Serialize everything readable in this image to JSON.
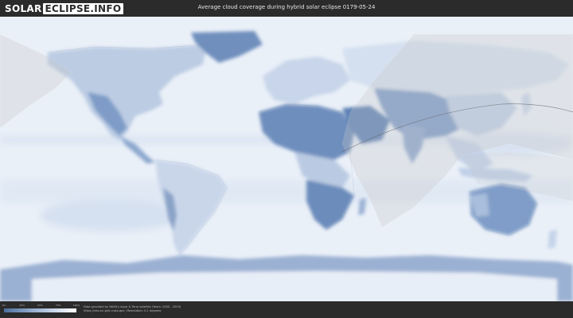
{
  "header": {
    "logo_part1": "SOLAR",
    "logo_part2": "ECLIPSE.INFO",
    "title": "Average cloud coverage during hybrid solar eclipse 0179-05-24"
  },
  "legend": {
    "ticks": [
      "0%",
      "25%",
      "50%",
      "75%",
      "100%"
    ],
    "gradient_colors": [
      "#4e6f9e",
      "#8aa3c7",
      "#c6d4e8",
      "#ffffff"
    ]
  },
  "credits": {
    "line1": "Data provided by NASA's Aqua & Terra satellite (Years: 2000 - 2019)",
    "line2": "https://neo.sci.gsfc.nasa.gov | Resolution: 0.1 degrees"
  },
  "colors": {
    "background": "#2b2b2b",
    "ocean_cloud": "#eef3fa",
    "land_clear": "#6f8fbd",
    "eclipse_overlay": "#c8c8c8"
  }
}
